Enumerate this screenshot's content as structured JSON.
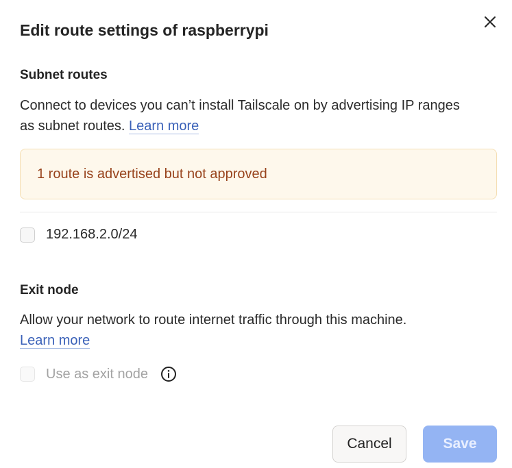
{
  "dialog": {
    "title": "Edit route settings of raspberrypi"
  },
  "subnet_routes": {
    "heading": "Subnet routes",
    "description": "Connect to devices you can’t install Tailscale on by advertising IP ranges as subnet routes.",
    "learn_more": "Learn more",
    "alert": "1 route is advertised but not approved",
    "routes": [
      {
        "label": "192.168.2.0/24",
        "checked": false
      }
    ]
  },
  "exit_node": {
    "heading": "Exit node",
    "description": "Allow your network to route internet traffic through this machine.",
    "learn_more": "Learn more",
    "checkbox_label": "Use as exit node",
    "checked": false,
    "disabled": true
  },
  "footer": {
    "cancel_label": "Cancel",
    "save_label": "Save"
  },
  "colors": {
    "link": "#3a61b8",
    "alert_bg": "#fef8ec",
    "alert_text": "#98431c",
    "save_bg": "#94b4f3"
  },
  "icons": {
    "close": "close-icon",
    "info": "info-icon"
  }
}
